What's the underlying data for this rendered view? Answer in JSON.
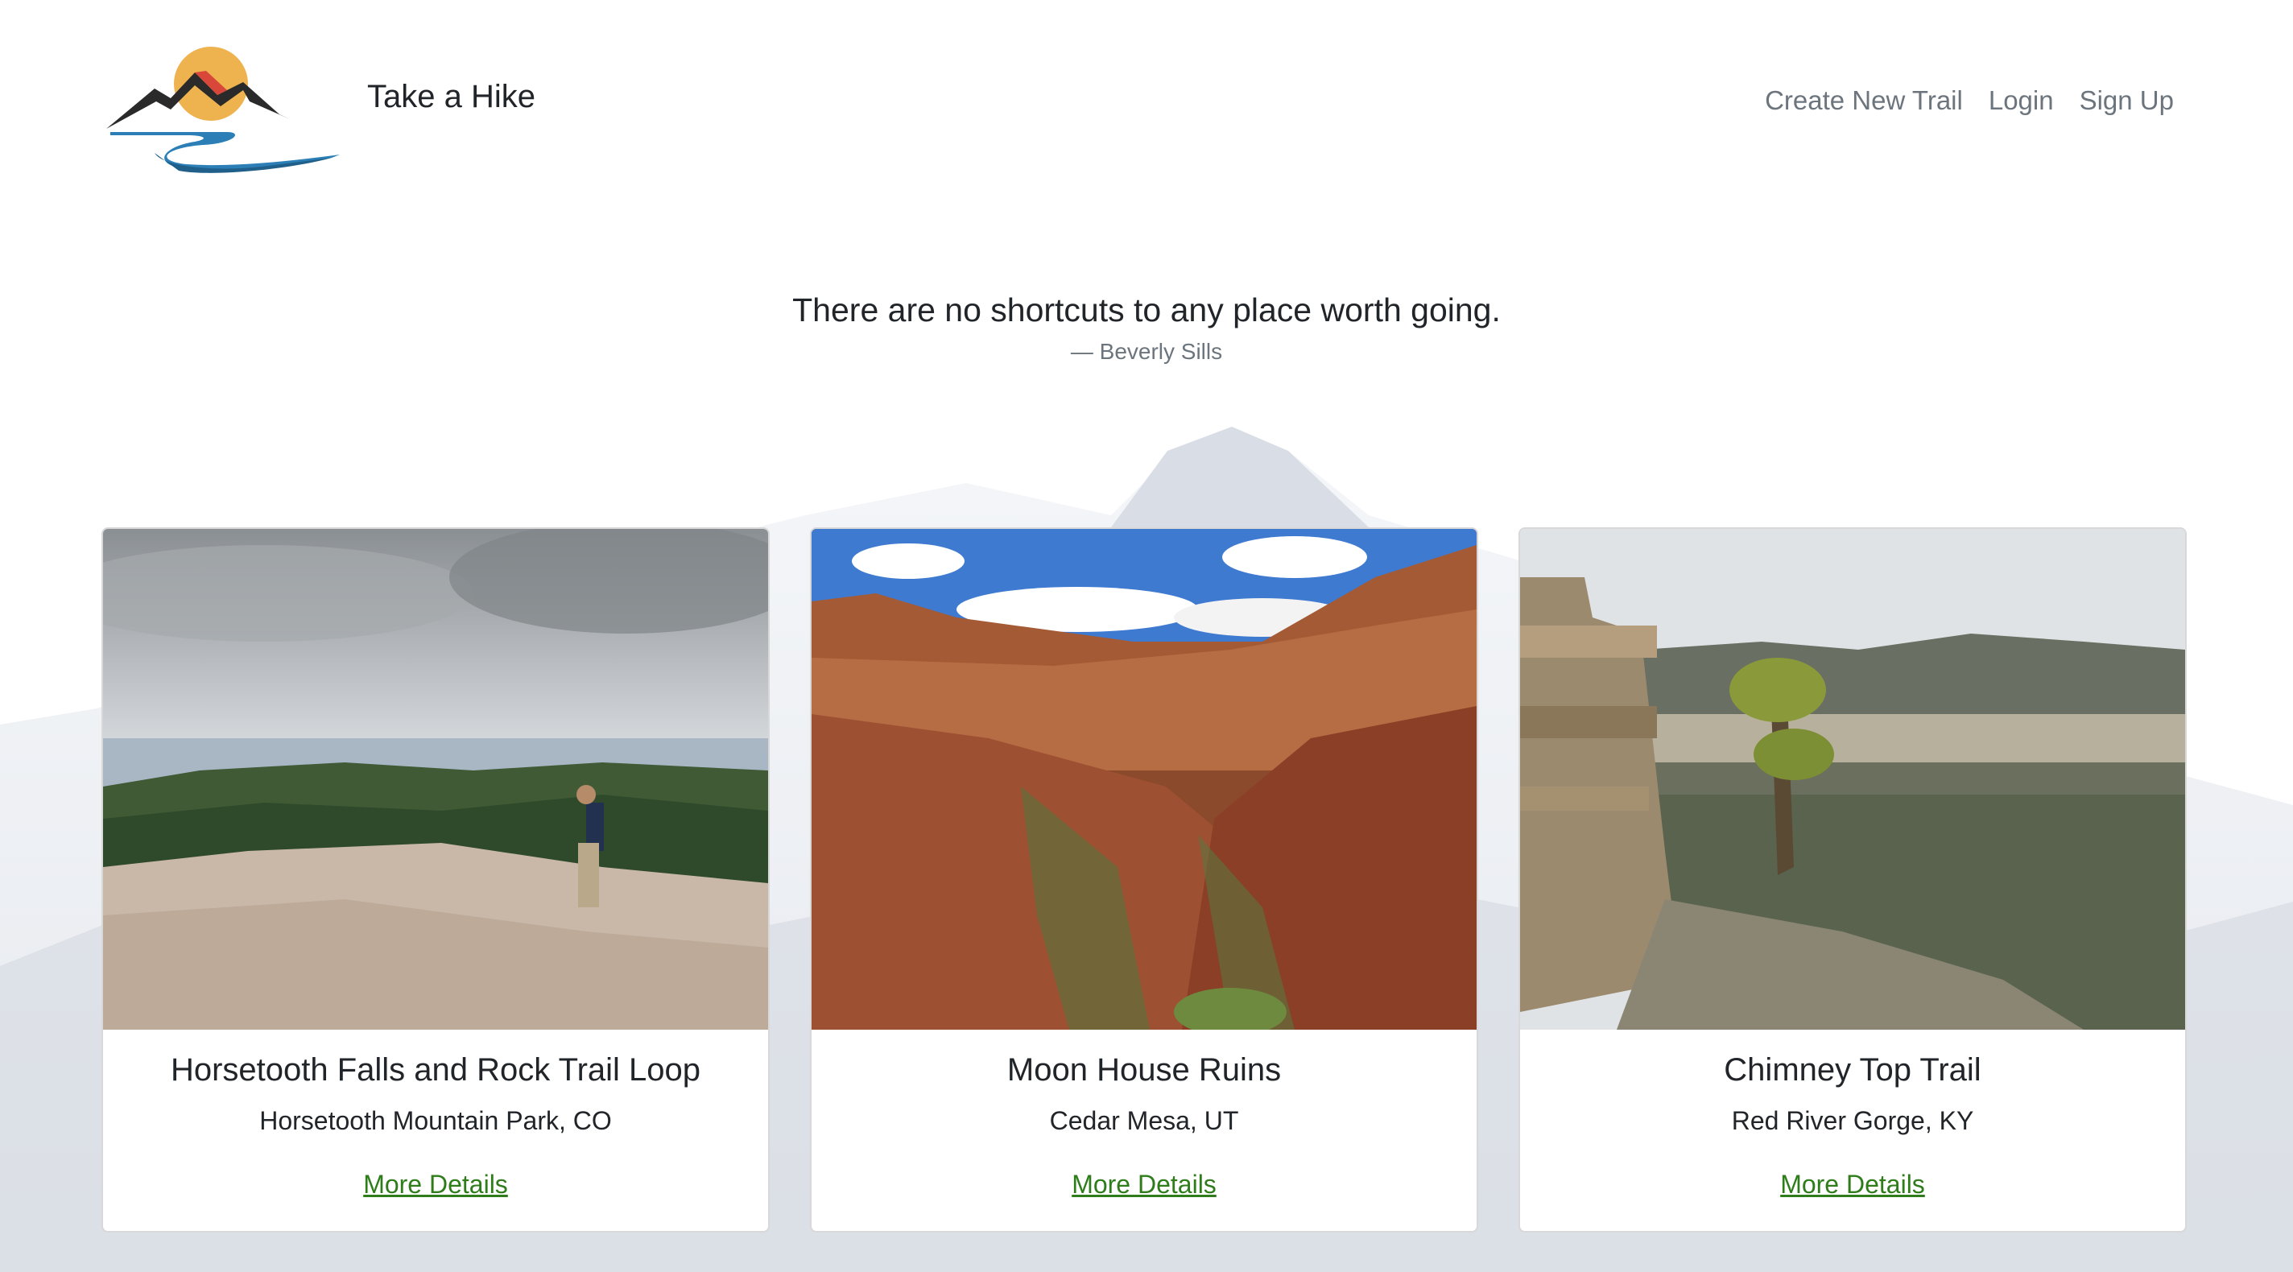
{
  "header": {
    "brand": "Take a Hike",
    "nav": [
      "Create New Trail",
      "Login",
      "Sign Up"
    ]
  },
  "quote": {
    "text": "There are no shortcuts to any place worth going.",
    "author": "— Beverly Sills"
  },
  "trails": [
    {
      "name": "Horsetooth Falls and Rock Trail Loop",
      "location": "Horsetooth Mountain Park, CO",
      "link": "More Details"
    },
    {
      "name": "Moon House Ruins",
      "location": "Cedar Mesa, UT",
      "link": "More Details"
    },
    {
      "name": "Chimney Top Trail",
      "location": "Red River Gorge, KY",
      "link": "More Details"
    }
  ],
  "colors": {
    "link": "#2e7d1a",
    "nav": "#6c757d",
    "sun": "#eeb24e",
    "mountain": "#2a2a2a",
    "river": "#2b7fb6"
  },
  "icons": [
    "logo-mountain-sun-river"
  ]
}
